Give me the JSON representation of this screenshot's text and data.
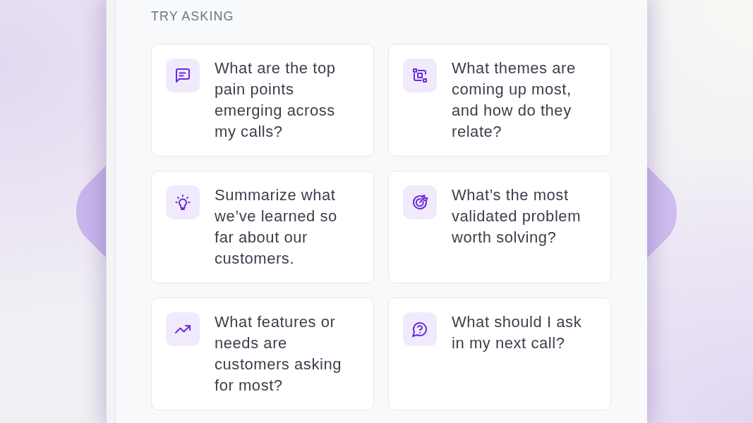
{
  "section_title": "TRY ASKING",
  "suggestions": [
    "What are the top pain points emerging across my calls?",
    "What themes are coming up most, and how do they relate?",
    "Summarize what we’ve learned so far about our customers.",
    "What’s the most validated problem worth solving?",
    "What features or needs are customers asking for most?",
    "What should I ask in my next call?"
  ]
}
